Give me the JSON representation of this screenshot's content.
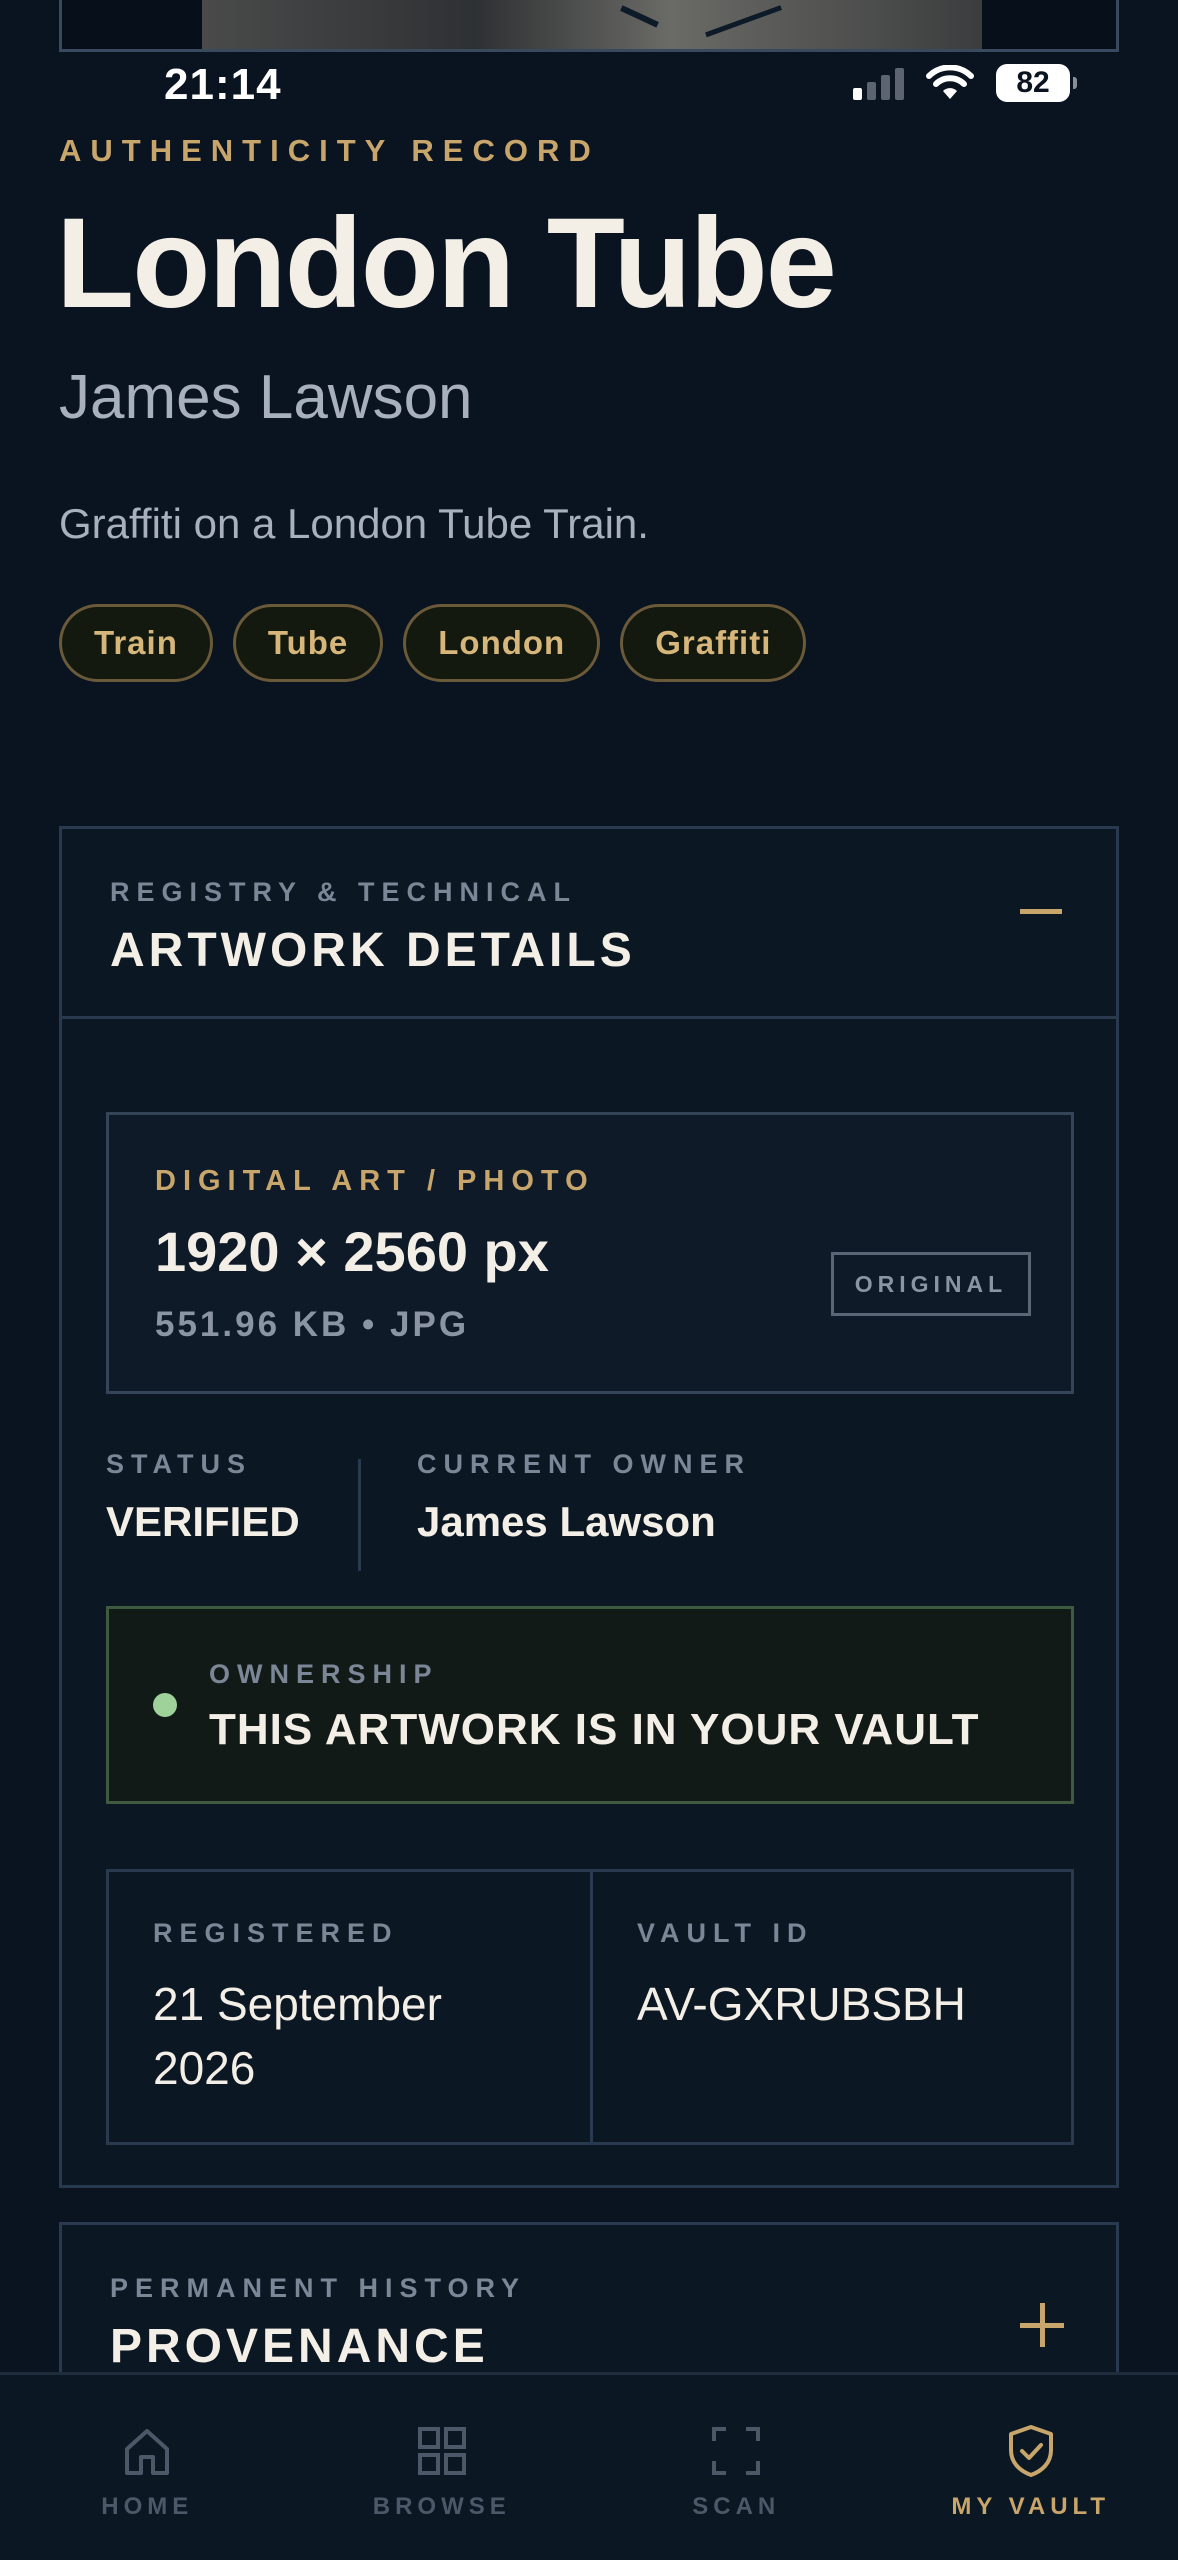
{
  "status_bar": {
    "time": "21:14",
    "battery": "82"
  },
  "record": {
    "eyebrow": "AUTHENTICITY RECORD",
    "title": "London Tube",
    "artist": "James Lawson",
    "description": "Graffiti on a London Tube Train.",
    "tags": [
      "Train",
      "Tube",
      "London",
      "Graffiti"
    ]
  },
  "details": {
    "eyebrow": "REGISTRY & TECHNICAL",
    "title": "ARTWORK DETAILS",
    "media": {
      "kind": "DIGITAL ART / PHOTO",
      "dimensions": "1920 × 2560 px",
      "file_info": "551.96 KB • JPG",
      "badge": "ORIGINAL"
    },
    "status_label": "STATUS",
    "status_value": "VERIFIED",
    "owner_label": "CURRENT OWNER",
    "owner_value": "James Lawson",
    "ownership_label": "OWNERSHIP",
    "ownership_text": "THIS ARTWORK IS IN YOUR VAULT",
    "registered_label": "REGISTERED",
    "registered_value": "21 September 2026",
    "vault_id_label": "VAULT ID",
    "vault_id_value": "AV-GXRUBSBH"
  },
  "provenance": {
    "eyebrow": "PERMANENT HISTORY",
    "title": "PROVENANCE"
  },
  "nav": {
    "items": [
      {
        "label": "HOME",
        "icon": "home-icon"
      },
      {
        "label": "BROWSE",
        "icon": "grid-icon"
      },
      {
        "label": "SCAN",
        "icon": "scan-icon"
      },
      {
        "label": "MY VAULT",
        "icon": "shield-check-icon",
        "active": true
      }
    ]
  },
  "colors": {
    "background": "#0a1320",
    "accent_gold": "#c8a66b",
    "text_primary": "#f4efe6",
    "text_muted": "#7b8696",
    "ownership_dot": "#9fd19b"
  }
}
